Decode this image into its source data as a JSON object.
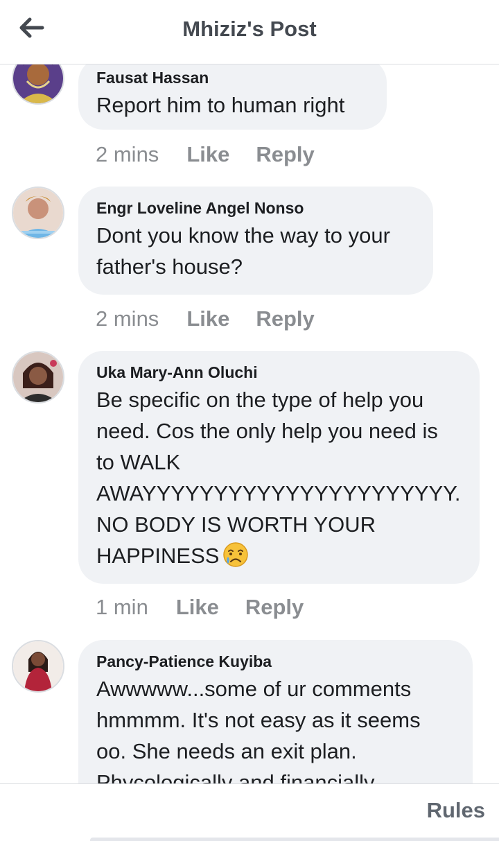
{
  "header": {
    "title": "Mhiziz's Post"
  },
  "comments": [
    {
      "author": "Fausat Hassan",
      "text": "Report him to human right",
      "time": "2 mins",
      "like": "Like",
      "reply": "Reply"
    },
    {
      "author": "Engr Loveline Angel Nonso",
      "text": "Dont you know the way to your\nfather's house?",
      "time": "2 mins",
      "like": "Like",
      "reply": "Reply"
    },
    {
      "author": "Uka Mary-Ann Oluchi",
      "text": "Be specific on the type of help you\nneed. Cos the only help you need is\nto WALK\nAWAYYYYYYYYYYYYYYYYYYYYYY.\nNO BODY IS WORTH YOUR\nHAPPINESS",
      "emoji": "crying-face",
      "time": "1 min",
      "like": "Like",
      "reply": "Reply"
    },
    {
      "author": "Pancy-Patience Kuyiba",
      "text": "Awwwww...some of ur comments\nhmmmm. It's not easy as it seems\noo. She needs an exit plan.\nPhycologically and financially",
      "time": "",
      "like": "",
      "reply": ""
    }
  ],
  "footer": {
    "rules_label": "Rules"
  },
  "icons": {
    "back": "arrow-left-icon"
  },
  "colors": {
    "bubble": "#f0f2f5",
    "meta_text": "#8a8d91",
    "header_title": "#444950"
  }
}
